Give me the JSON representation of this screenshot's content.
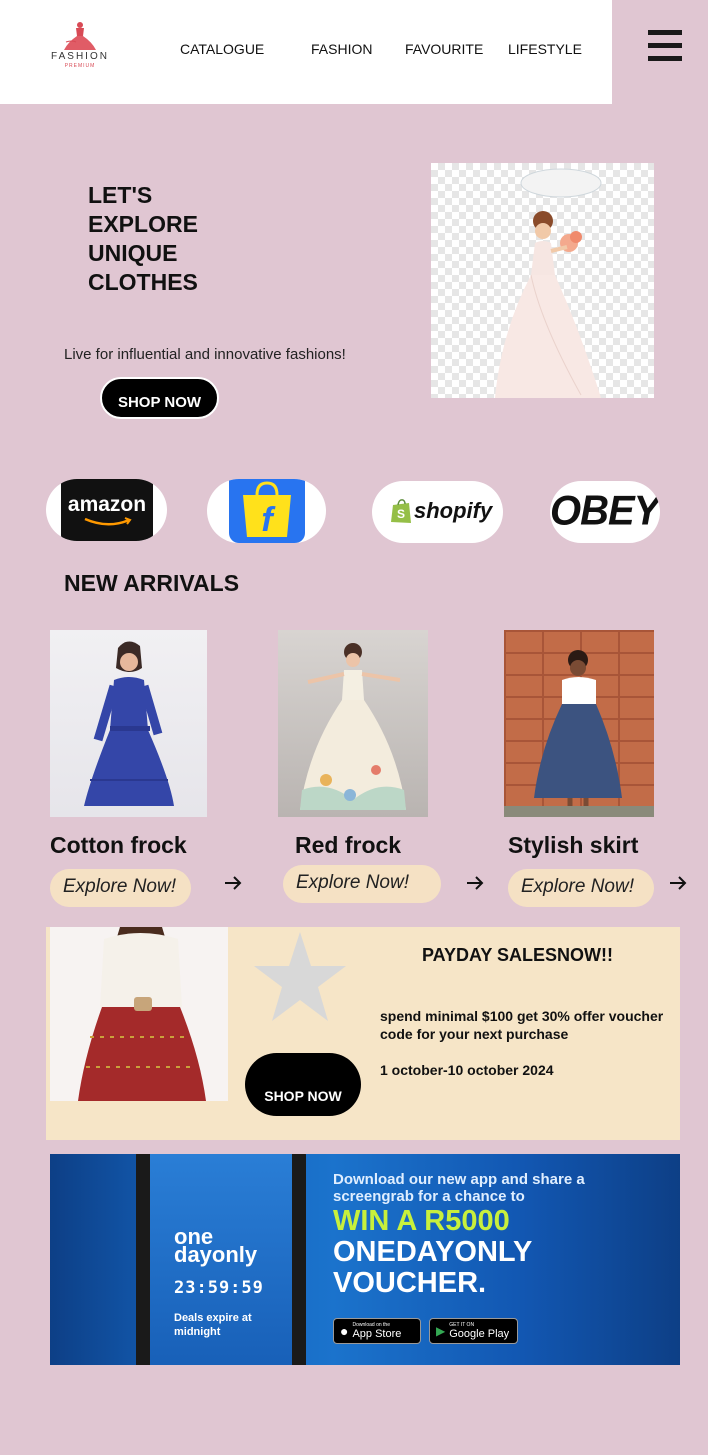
{
  "brand": {
    "name": "FASHION",
    "tagline": "PREMIUM"
  },
  "nav": {
    "items": [
      "CATALOGUE",
      "FASHION",
      "FAVOURITE",
      "LIFESTYLE"
    ]
  },
  "hero": {
    "title": "LET'S EXPLORE UNIQUE CLOTHES",
    "subtitle": "Live for influential and innovative fashions!",
    "button": "SHOP NOW"
  },
  "brands": [
    "amazon",
    "flipkart",
    "shopify",
    "OBEY"
  ],
  "new_arrivals": {
    "title": "NEW ARRIVALS",
    "products": [
      {
        "name": "Cotton frock",
        "cta": "Explore Now!"
      },
      {
        "name": "Red frock",
        "cta": "Explore Now!"
      },
      {
        "name": "Stylish skirt",
        "cta": "Explore Now!"
      }
    ]
  },
  "promo": {
    "title": "PAYDAY SALESNOW!!",
    "text": "spend minimal $100 get 30% offer voucher code for your next purchase",
    "dates": "1 october-10 october 2024",
    "button": "SHOP NOW"
  },
  "app_banner": {
    "logo_line1": "one",
    "logo_line2": "dayonly",
    "timer": "23:59:59",
    "expire": "Deals expire at midnight",
    "download": "Download our new app and share a screengrab for a chance to",
    "win": "WIN A R5000",
    "voucher": "ONEDAYONLY VOUCHER.",
    "app_store_small": "Download on the",
    "app_store": "App Store",
    "play_small": "GET IT ON",
    "play": "Google Play"
  },
  "colors": {
    "background": "#e0c6d2",
    "header": "#ffffff",
    "explore_pill": "#f5e1c4",
    "promo_bg": "#f6e5c7",
    "button": "#000000",
    "banner_blue": "#1565c0",
    "banner_green": "#c8f03c"
  },
  "icons": [
    "dress-logo-icon",
    "hamburger-menu-icon",
    "arrow-right-icon",
    "star-icon",
    "apple-icon",
    "play-icon"
  ]
}
